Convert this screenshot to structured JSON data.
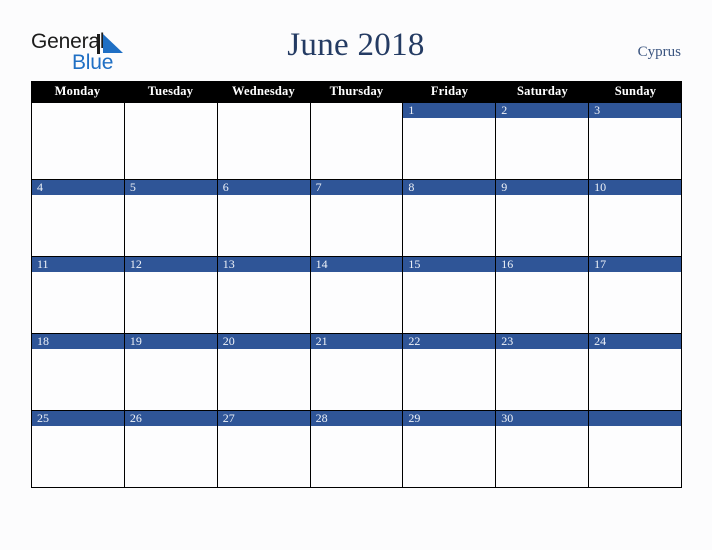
{
  "brand": {
    "logo_line1": "General",
    "logo_line2": "Blue",
    "logo_triangle_icon": "triangle-icon",
    "dark_color": "#1c1c1c",
    "blue_color": "#1f6fc4"
  },
  "header": {
    "title": "June 2018",
    "country": "Cyprus",
    "title_color": "#243b63"
  },
  "calendar": {
    "accent_color": "#2f5597",
    "header_bg": "#000000",
    "header_text_color": "#ffffff",
    "cell_bg": "#fdfdfe",
    "day_names": [
      "Monday",
      "Tuesday",
      "Wednesday",
      "Thursday",
      "Friday",
      "Saturday",
      "Sunday"
    ],
    "weeks": [
      [
        {
          "day": "",
          "filled": false
        },
        {
          "day": "",
          "filled": false
        },
        {
          "day": "",
          "filled": false
        },
        {
          "day": "",
          "filled": false
        },
        {
          "day": "1",
          "filled": true
        },
        {
          "day": "2",
          "filled": true
        },
        {
          "day": "3",
          "filled": true
        }
      ],
      [
        {
          "day": "4",
          "filled": true
        },
        {
          "day": "5",
          "filled": true
        },
        {
          "day": "6",
          "filled": true
        },
        {
          "day": "7",
          "filled": true
        },
        {
          "day": "8",
          "filled": true
        },
        {
          "day": "9",
          "filled": true
        },
        {
          "day": "10",
          "filled": true
        }
      ],
      [
        {
          "day": "11",
          "filled": true
        },
        {
          "day": "12",
          "filled": true
        },
        {
          "day": "13",
          "filled": true
        },
        {
          "day": "14",
          "filled": true
        },
        {
          "day": "15",
          "filled": true
        },
        {
          "day": "16",
          "filled": true
        },
        {
          "day": "17",
          "filled": true
        }
      ],
      [
        {
          "day": "18",
          "filled": true
        },
        {
          "day": "19",
          "filled": true
        },
        {
          "day": "20",
          "filled": true
        },
        {
          "day": "21",
          "filled": true
        },
        {
          "day": "22",
          "filled": true
        },
        {
          "day": "23",
          "filled": true
        },
        {
          "day": "24",
          "filled": true
        }
      ],
      [
        {
          "day": "25",
          "filled": true
        },
        {
          "day": "26",
          "filled": true
        },
        {
          "day": "27",
          "filled": true
        },
        {
          "day": "28",
          "filled": true
        },
        {
          "day": "29",
          "filled": true
        },
        {
          "day": "30",
          "filled": true
        },
        {
          "day": "",
          "filled": true
        }
      ]
    ]
  }
}
